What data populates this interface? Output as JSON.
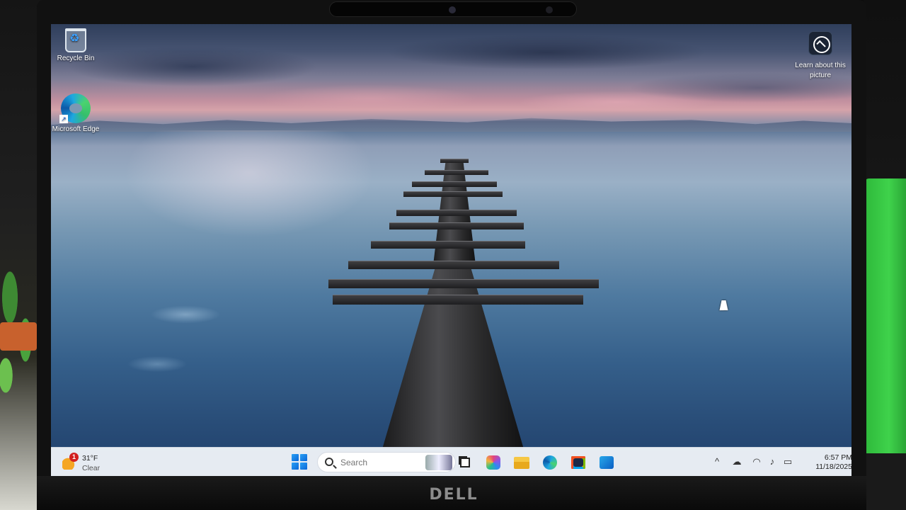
{
  "desktop": {
    "icons": [
      {
        "label": "Recycle Bin",
        "icon": "recycle-bin-icon"
      },
      {
        "label": "Microsoft Edge",
        "icon": "edge-icon"
      }
    ],
    "spotlight": {
      "label": "Learn about this picture",
      "icon": "camera-learn-icon"
    },
    "cursor": "arrow-cursor"
  },
  "taskbar": {
    "weather": {
      "temp": "31°F",
      "condition": "Clear",
      "badge": "1"
    },
    "search": {
      "placeholder": "Search"
    },
    "apps": [
      {
        "name": "Task View",
        "icon": "task-view-icon"
      },
      {
        "name": "Microsoft 365 Copilot",
        "icon": "m365-icon"
      },
      {
        "name": "File Explorer",
        "icon": "folder-icon"
      },
      {
        "name": "Microsoft Edge",
        "icon": "edge-icon"
      },
      {
        "name": "Microsoft Store",
        "icon": "store-icon"
      },
      {
        "name": "Outlook",
        "icon": "outlook-icon"
      }
    ],
    "tray": {
      "time": "6:57 PM",
      "date": "11/18/2025",
      "icons": [
        "chevron-up-icon",
        "onedrive-cloud-icon",
        "wifi-icon",
        "volume-icon",
        "battery-icon"
      ]
    }
  },
  "hardware": {
    "brand": "DELL"
  }
}
